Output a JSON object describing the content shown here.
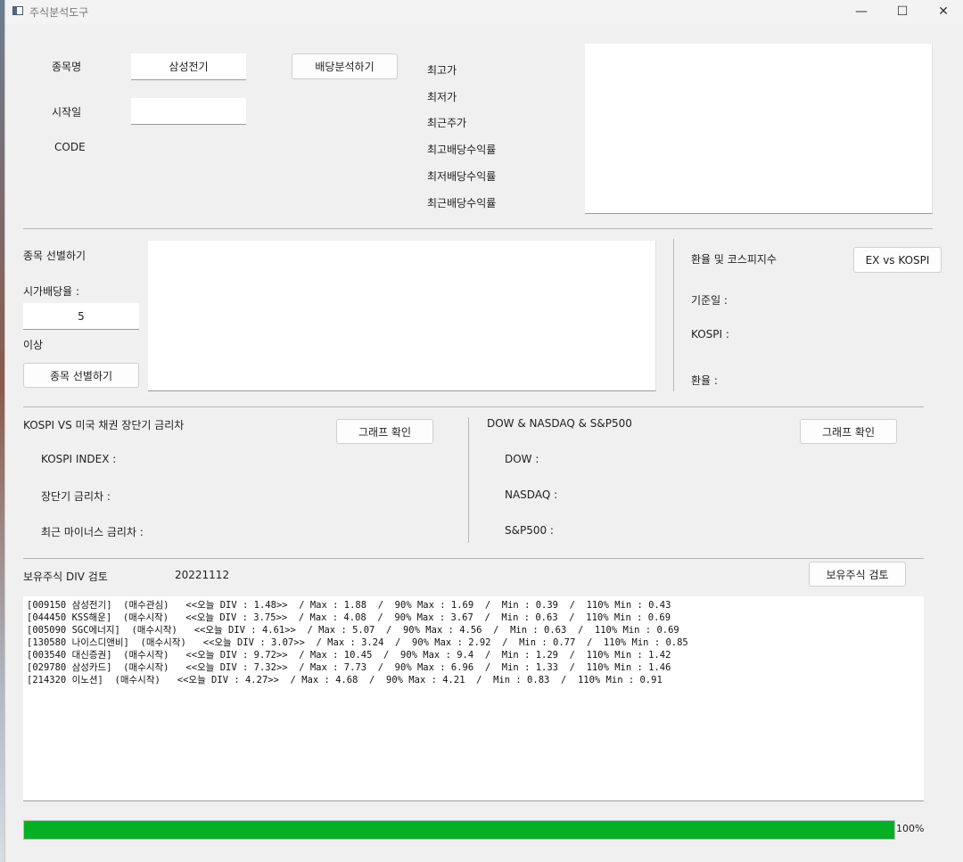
{
  "window": {
    "title": "주식분석도구",
    "min": "—",
    "max": "☐",
    "close": "✕"
  },
  "dividend": {
    "stock_name_label": "종목명",
    "stock_name_value": "삼성전기",
    "start_date_label": "시작일",
    "start_date_value": "",
    "code_label": "CODE",
    "analyze_button": "배당분석하기",
    "stats": [
      "최고가",
      "최저가",
      "최근주가",
      "최고배당수익률",
      "최저배당수익률",
      "최근배당수익률"
    ]
  },
  "selection": {
    "title": "종목 선별하기",
    "yield_label": "시가배당율 :",
    "yield_value": "5",
    "above_label": "이상",
    "select_button": "종목 선별하기"
  },
  "exchange": {
    "title": "환율 및 코스피지수",
    "button": "EX vs KOSPI",
    "base_date": "기준일 :",
    "kospi": "KOSPI :",
    "rate": "환율 :"
  },
  "kospi_bond": {
    "title": "KOSPI VS 미국 채권 장단기 금리차",
    "button": "그래프 확인",
    "index_label": "KOSPI INDEX :",
    "spread_label": "장단기 금리차 :",
    "recent_minus_label": "최근 마이너스 금리차 :"
  },
  "us_index": {
    "title": "DOW & NASDAQ & S&P500",
    "button": "그래프 확인",
    "dow": "DOW :",
    "nasdaq": "NASDAQ :",
    "sp500": "S&P500 :"
  },
  "holdings": {
    "title": "보유주식 DIV 검토",
    "date": "20221112",
    "button": "보유주식 검토",
    "lines": [
      "[009150 삼성전기]  (매수관심)   <<오늘 DIV : 1.48>>  / Max : 1.88  /  90% Max : 1.69  /  Min : 0.39  /  110% Min : 0.43",
      "[044450 KSS해운]  (매수시작)   <<오늘 DIV : 3.75>>  / Max : 4.08  /  90% Max : 3.67  /  Min : 0.63  /  110% Min : 0.69",
      "[005090 SGC에너지]  (매수시작)   <<오늘 DIV : 4.61>>  / Max : 5.07  /  90% Max : 4.56  /  Min : 0.63  /  110% Min : 0.69",
      "[130580 나이스디앤비]  (매수시작)   <<오늘 DIV : 3.07>>  / Max : 3.24  /  90% Max : 2.92  /  Min : 0.77  /  110% Min : 0.85",
      "[003540 대신증권]  (매수시작)   <<오늘 DIV : 9.72>>  / Max : 10.45  /  90% Max : 9.4  /  Min : 1.29  /  110% Min : 1.42",
      "[029780 삼성카드]  (매수시작)   <<오늘 DIV : 7.32>>  / Max : 7.73  /  90% Max : 6.96  /  Min : 1.33  /  110% Min : 1.46",
      "[214320 이노션]  (매수시작)   <<오늘 DIV : 4.27>>  / Max : 4.68  /  90% Max : 4.21  /  Min : 0.83  /  110% Min : 0.91"
    ]
  },
  "progress": {
    "value": 1.0,
    "label": "100%",
    "color": "#06b025"
  }
}
